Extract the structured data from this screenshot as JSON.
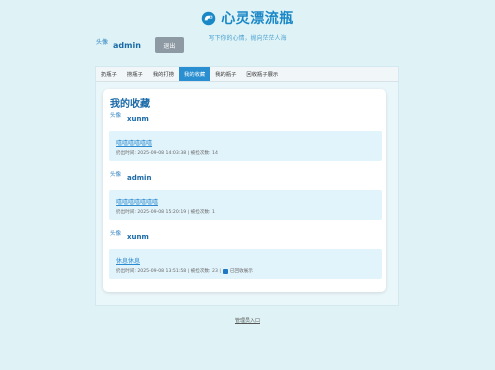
{
  "header": {
    "title": "心灵漂流瓶",
    "subtitle": "写下你的心情，抛向茫茫人海",
    "logo_icon": "bottle-icon"
  },
  "user": {
    "avatar_label": "头像",
    "name": "admin",
    "logout_label": "退出"
  },
  "tabs": [
    {
      "label": "扔瓶子",
      "active": false
    },
    {
      "label": "捞瓶子",
      "active": false
    },
    {
      "label": "我的打捞",
      "active": false
    },
    {
      "label": "我的收藏",
      "active": true
    },
    {
      "label": "我的瓶子",
      "active": false
    },
    {
      "label": "回收瓶子展示",
      "active": false
    }
  ],
  "main": {
    "heading": "我的收藏",
    "items": [
      {
        "avatar_label": "头像",
        "author": "xunm",
        "title": "嘻嘻嘻嘻嘻嘻",
        "meta": "扔出时间: 2025-09-08 14:03:38 | 被捡次数: 14",
        "replied_label": ""
      },
      {
        "avatar_label": "头像",
        "author": "admin",
        "title": "嘻嘻嘻嘻嘻嘻嘻",
        "meta": "扔出时间: 2025-09-08 15:20:19 | 被捡次数: 1",
        "replied_label": ""
      },
      {
        "avatar_label": "头像",
        "author": "xunm",
        "title": "休息休息",
        "meta": "扔出时间: 2025-09-08 13:51:58 | 被捡次数: 23 |",
        "replied_label": "已回收展示"
      }
    ]
  },
  "footer": {
    "link_label": "管理员入口"
  },
  "colors": {
    "accent": "#1a87c7",
    "background": "#dff3f6",
    "active_tab": "#2a8fd0"
  }
}
